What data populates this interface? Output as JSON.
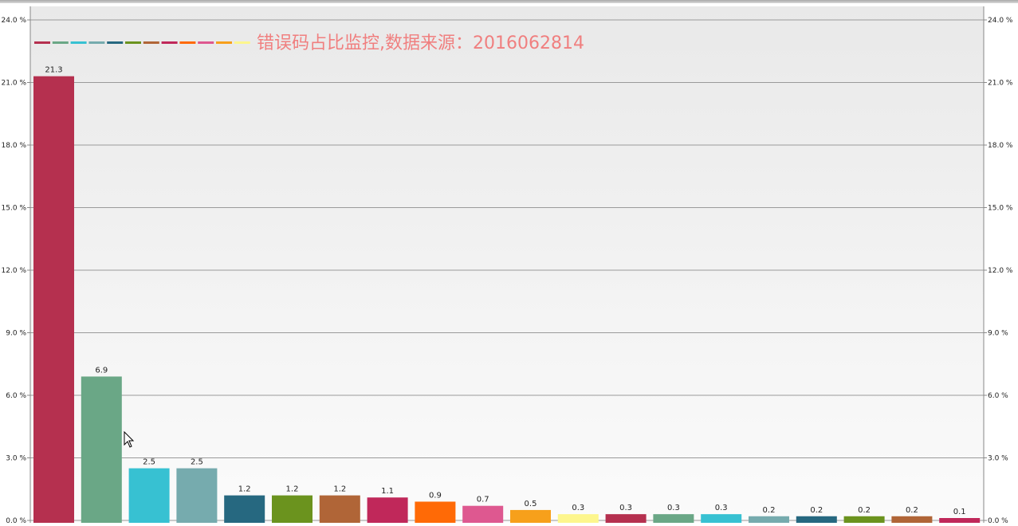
{
  "chart_data": {
    "type": "bar",
    "title": "错误码占比监控,数据来源：2016062814",
    "ylim": [
      0,
      24
    ],
    "y_ticks": [
      "0.0 %",
      "3.0 %",
      "6.0 %",
      "9.0 %",
      "12.0 %",
      "15.0 %",
      "18.0 %",
      "21.0 %",
      "24.0 %"
    ],
    "y_tick_values": [
      0,
      3,
      6,
      9,
      12,
      15,
      18,
      21,
      24
    ],
    "dual_y_axis": true,
    "grid": true,
    "legend_position": "top-left",
    "values": [
      21.3,
      6.9,
      2.5,
      2.5,
      1.2,
      1.2,
      1.2,
      1.1,
      0.9,
      0.7,
      0.5,
      0.3,
      0.3,
      0.3,
      0.3,
      0.2,
      0.2,
      0.2,
      0.2,
      0.1
    ],
    "value_labels": [
      "21.3",
      "6.9",
      "2.5",
      "2.5",
      "1.2",
      "1.2",
      "1.2",
      "1.1",
      "0.9",
      "0.7",
      "0.5",
      "0.3",
      "0.3",
      "0.3",
      "0.3",
      "0.2",
      "0.2",
      "0.2",
      "0.2",
      "0.1"
    ],
    "colors": [
      "#B5304F",
      "#6AA786",
      "#37C1D2",
      "#76ABAE",
      "#266880",
      "#6B931E",
      "#B06537",
      "#C0285A",
      "#FF6A06",
      "#DE5890",
      "#F7A01B",
      "#FDF68D",
      "#B5304F",
      "#6AA786",
      "#37C1D2",
      "#76ABAE",
      "#266880",
      "#6B931E",
      "#B06537",
      "#C0285A"
    ],
    "legend_colors": [
      "#B5304F",
      "#6AA786",
      "#37C1D2",
      "#76ABAE",
      "#266880",
      "#6B931E",
      "#B06537",
      "#C0285A",
      "#FF6A06",
      "#DE5890",
      "#F7A01B",
      "#FDF68D"
    ],
    "title_color": "#F07F7F"
  }
}
